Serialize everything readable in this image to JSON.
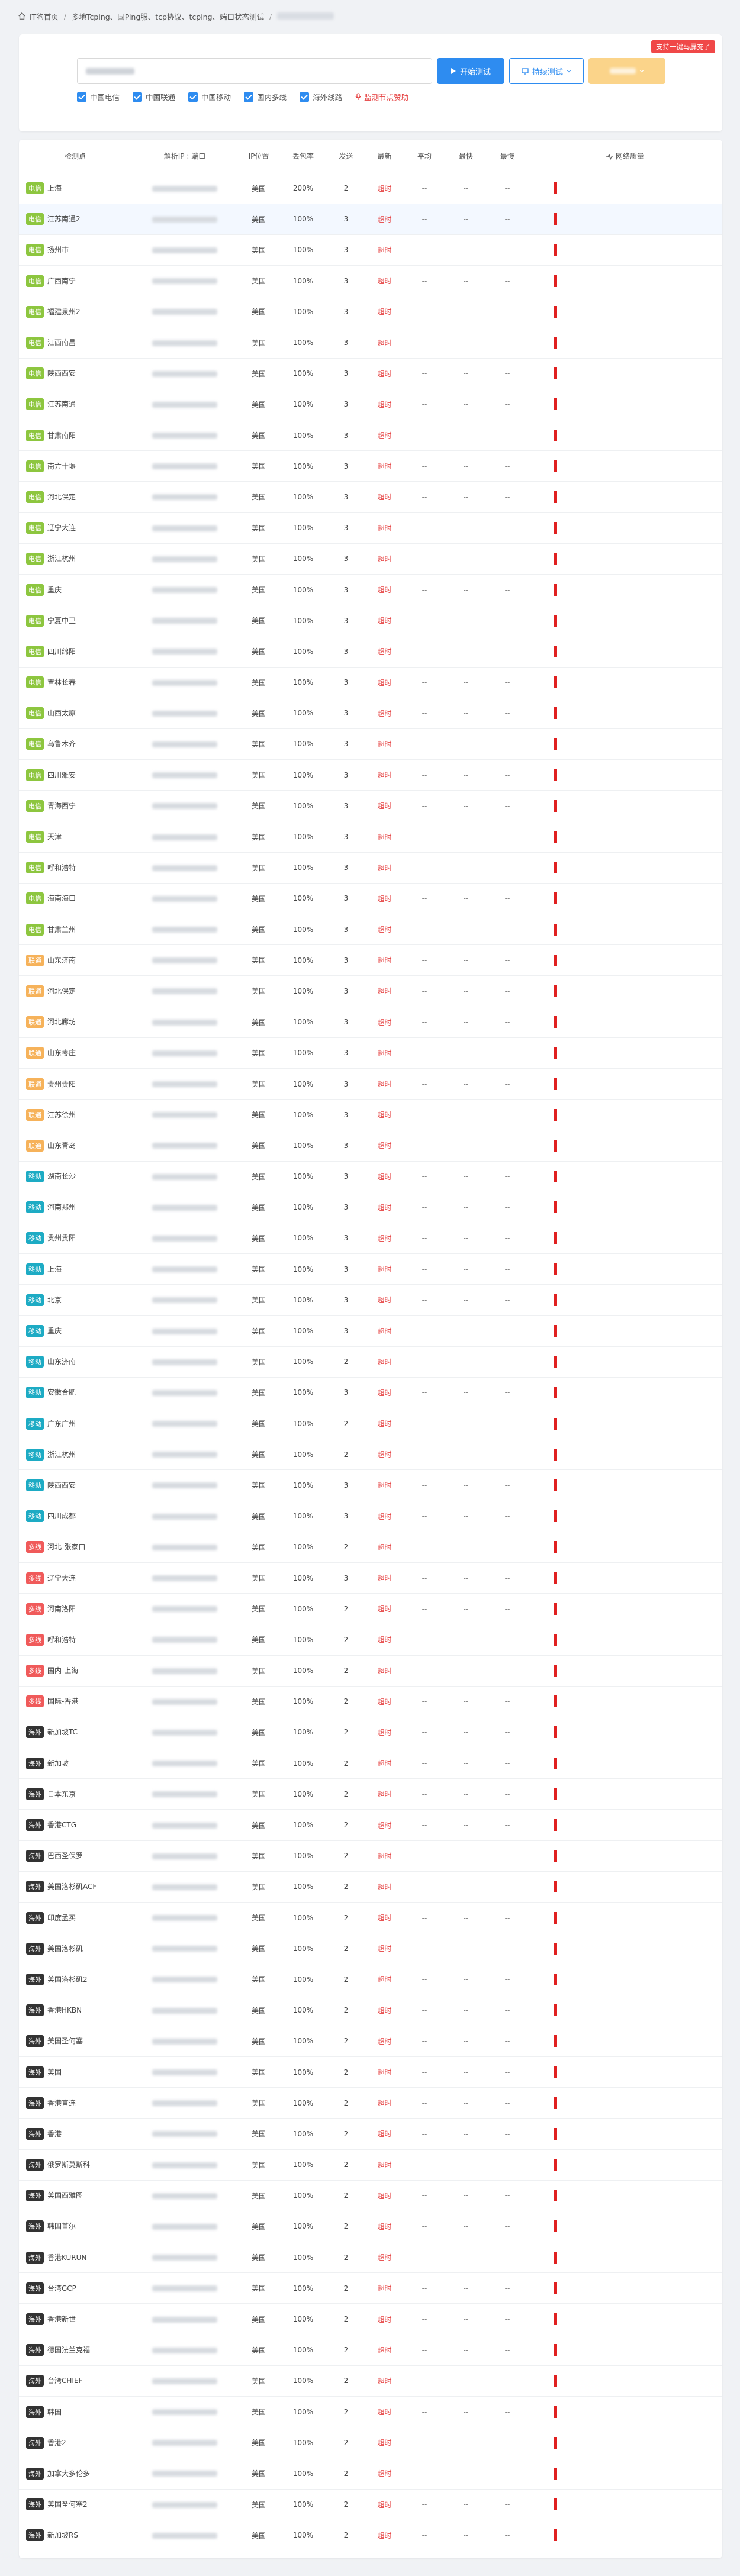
{
  "colors": {
    "电信": "#8dc63f",
    "联通": "#f6b25a",
    "移动": "#1dabc4",
    "多线": "#f05a5a",
    "海外": "#333333",
    "accent": "#2e8cf0",
    "timeout": "#e53e3e"
  },
  "breadcrumb": {
    "home": "IT狗首页",
    "middle": "多地Tcping、国Ping服、tcp协议、tcping、端口状态测试"
  },
  "top": {
    "corner_badge": "支持一键马屏充了",
    "start_button": "开始测试",
    "continuous_button": "持续测试",
    "checkboxes": [
      "中国电信",
      "中国联通",
      "中国移动",
      "国内多线",
      "海外线路"
    ],
    "donate": "监测节点赞助"
  },
  "table": {
    "headers": [
      "检测点",
      "解析IP : 端口",
      "IP位置",
      "丢包率",
      "发送",
      "最新",
      "平均",
      "最快",
      "最慢",
      "网络质量"
    ],
    "rows": [
      {
        "tag": "电信",
        "name": "上海",
        "loc": "美国",
        "loss": "200%",
        "sent": "2"
      },
      {
        "tag": "电信",
        "name": "江苏南通2",
        "loc": "美国",
        "loss": "100%",
        "sent": "3"
      },
      {
        "tag": "电信",
        "name": "扬州市",
        "loc": "美国",
        "loss": "100%",
        "sent": "3"
      },
      {
        "tag": "电信",
        "name": "广西南宁",
        "loc": "美国",
        "loss": "100%",
        "sent": "3"
      },
      {
        "tag": "电信",
        "name": "福建泉州2",
        "loc": "美国",
        "loss": "100%",
        "sent": "3"
      },
      {
        "tag": "电信",
        "name": "江西南昌",
        "loc": "美国",
        "loss": "100%",
        "sent": "3"
      },
      {
        "tag": "电信",
        "name": "陕西西安",
        "loc": "美国",
        "loss": "100%",
        "sent": "3"
      },
      {
        "tag": "电信",
        "name": "江苏南通",
        "loc": "美国",
        "loss": "100%",
        "sent": "3"
      },
      {
        "tag": "电信",
        "name": "甘肃南阳",
        "loc": "美国",
        "loss": "100%",
        "sent": "3"
      },
      {
        "tag": "电信",
        "name": "南方十堰",
        "loc": "美国",
        "loss": "100%",
        "sent": "3"
      },
      {
        "tag": "电信",
        "name": "河北保定",
        "loc": "美国",
        "loss": "100%",
        "sent": "3"
      },
      {
        "tag": "电信",
        "name": "辽宁大连",
        "loc": "美国",
        "loss": "100%",
        "sent": "3"
      },
      {
        "tag": "电信",
        "name": "浙江杭州",
        "loc": "美国",
        "loss": "100%",
        "sent": "3"
      },
      {
        "tag": "电信",
        "name": "重庆",
        "loc": "美国",
        "loss": "100%",
        "sent": "3"
      },
      {
        "tag": "电信",
        "name": "宁夏中卫",
        "loc": "美国",
        "loss": "100%",
        "sent": "3"
      },
      {
        "tag": "电信",
        "name": "四川绵阳",
        "loc": "美国",
        "loss": "100%",
        "sent": "3"
      },
      {
        "tag": "电信",
        "name": "吉林长春",
        "loc": "美国",
        "loss": "100%",
        "sent": "3"
      },
      {
        "tag": "电信",
        "name": "山西太原",
        "loc": "美国",
        "loss": "100%",
        "sent": "3"
      },
      {
        "tag": "电信",
        "name": "乌鲁木齐",
        "loc": "美国",
        "loss": "100%",
        "sent": "3"
      },
      {
        "tag": "电信",
        "name": "四川雅安",
        "loc": "美国",
        "loss": "100%",
        "sent": "3"
      },
      {
        "tag": "电信",
        "name": "青海西宁",
        "loc": "美国",
        "loss": "100%",
        "sent": "3"
      },
      {
        "tag": "电信",
        "name": "天津",
        "loc": "美国",
        "loss": "100%",
        "sent": "3"
      },
      {
        "tag": "电信",
        "name": "呼和浩特",
        "loc": "美国",
        "loss": "100%",
        "sent": "3"
      },
      {
        "tag": "电信",
        "name": "海南海口",
        "loc": "美国",
        "loss": "100%",
        "sent": "3"
      },
      {
        "tag": "电信",
        "name": "甘肃兰州",
        "loc": "美国",
        "loss": "100%",
        "sent": "3"
      },
      {
        "tag": "联通",
        "name": "山东济南",
        "loc": "美国",
        "loss": "100%",
        "sent": "3"
      },
      {
        "tag": "联通",
        "name": "河北保定",
        "loc": "美国",
        "loss": "100%",
        "sent": "3"
      },
      {
        "tag": "联通",
        "name": "河北廊坊",
        "loc": "美国",
        "loss": "100%",
        "sent": "3"
      },
      {
        "tag": "联通",
        "name": "山东枣庄",
        "loc": "美国",
        "loss": "100%",
        "sent": "3"
      },
      {
        "tag": "联通",
        "name": "贵州贵阳",
        "loc": "美国",
        "loss": "100%",
        "sent": "3"
      },
      {
        "tag": "联通",
        "name": "江苏徐州",
        "loc": "美国",
        "loss": "100%",
        "sent": "3"
      },
      {
        "tag": "联通",
        "name": "山东青岛",
        "loc": "美国",
        "loss": "100%",
        "sent": "3"
      },
      {
        "tag": "移动",
        "name": "湖南长沙",
        "loc": "美国",
        "loss": "100%",
        "sent": "3"
      },
      {
        "tag": "移动",
        "name": "河南郑州",
        "loc": "美国",
        "loss": "100%",
        "sent": "3"
      },
      {
        "tag": "移动",
        "name": "贵州贵阳",
        "loc": "美国",
        "loss": "100%",
        "sent": "3"
      },
      {
        "tag": "移动",
        "name": "上海",
        "loc": "美国",
        "loss": "100%",
        "sent": "3"
      },
      {
        "tag": "移动",
        "name": "北京",
        "loc": "美国",
        "loss": "100%",
        "sent": "3"
      },
      {
        "tag": "移动",
        "name": "重庆",
        "loc": "美国",
        "loss": "100%",
        "sent": "3"
      },
      {
        "tag": "移动",
        "name": "山东济南",
        "loc": "美国",
        "loss": "100%",
        "sent": "2"
      },
      {
        "tag": "移动",
        "name": "安徽合肥",
        "loc": "美国",
        "loss": "100%",
        "sent": "3"
      },
      {
        "tag": "移动",
        "name": "广东广州",
        "loc": "美国",
        "loss": "100%",
        "sent": "2"
      },
      {
        "tag": "移动",
        "name": "浙江杭州",
        "loc": "美国",
        "loss": "100%",
        "sent": "2"
      },
      {
        "tag": "移动",
        "name": "陕西西安",
        "loc": "美国",
        "loss": "100%",
        "sent": "3"
      },
      {
        "tag": "移动",
        "name": "四川成都",
        "loc": "美国",
        "loss": "100%",
        "sent": "3"
      },
      {
        "tag": "多线",
        "name": "河北-张家口",
        "loc": "美国",
        "loss": "100%",
        "sent": "2"
      },
      {
        "tag": "多线",
        "name": "辽宁大连",
        "loc": "美国",
        "loss": "100%",
        "sent": "3"
      },
      {
        "tag": "多线",
        "name": "河南洛阳",
        "loc": "美国",
        "loss": "100%",
        "sent": "2"
      },
      {
        "tag": "多线",
        "name": "呼和浩特",
        "loc": "美国",
        "loss": "100%",
        "sent": "2"
      },
      {
        "tag": "多线",
        "name": "国内-上海",
        "loc": "美国",
        "loss": "100%",
        "sent": "2"
      },
      {
        "tag": "多线",
        "name": "国际-香港",
        "loc": "美国",
        "loss": "100%",
        "sent": "2"
      },
      {
        "tag": "海外",
        "name": "新加坡TC",
        "loc": "美国",
        "loss": "100%",
        "sent": "2"
      },
      {
        "tag": "海外",
        "name": "新加坡",
        "loc": "美国",
        "loss": "100%",
        "sent": "2"
      },
      {
        "tag": "海外",
        "name": "日本东京",
        "loc": "美国",
        "loss": "100%",
        "sent": "2"
      },
      {
        "tag": "海外",
        "name": "香港CTG",
        "loc": "美国",
        "loss": "100%",
        "sent": "2"
      },
      {
        "tag": "海外",
        "name": "巴西圣保罗",
        "loc": "美国",
        "loss": "100%",
        "sent": "2"
      },
      {
        "tag": "海外",
        "name": "美国洛杉矶ACF",
        "loc": "美国",
        "loss": "100%",
        "sent": "2"
      },
      {
        "tag": "海外",
        "name": "印度孟买",
        "loc": "美国",
        "loss": "100%",
        "sent": "2"
      },
      {
        "tag": "海外",
        "name": "美国洛杉矶",
        "loc": "美国",
        "loss": "100%",
        "sent": "2"
      },
      {
        "tag": "海外",
        "name": "美国洛杉矶2",
        "loc": "美国",
        "loss": "100%",
        "sent": "2"
      },
      {
        "tag": "海外",
        "name": "香港HKBN",
        "loc": "美国",
        "loss": "100%",
        "sent": "2"
      },
      {
        "tag": "海外",
        "name": "美国圣何塞",
        "loc": "美国",
        "loss": "100%",
        "sent": "2"
      },
      {
        "tag": "海外",
        "name": "美国",
        "loc": "美国",
        "loss": "100%",
        "sent": "2"
      },
      {
        "tag": "海外",
        "name": "香港直连",
        "loc": "美国",
        "loss": "100%",
        "sent": "2"
      },
      {
        "tag": "海外",
        "name": "香港",
        "loc": "美国",
        "loss": "100%",
        "sent": "2"
      },
      {
        "tag": "海外",
        "name": "俄罗斯莫斯科",
        "loc": "美国",
        "loss": "100%",
        "sent": "2"
      },
      {
        "tag": "海外",
        "name": "美国西雅图",
        "loc": "美国",
        "loss": "100%",
        "sent": "2"
      },
      {
        "tag": "海外",
        "name": "韩国首尔",
        "loc": "美国",
        "loss": "100%",
        "sent": "2"
      },
      {
        "tag": "海外",
        "name": "香港KURUN",
        "loc": "美国",
        "loss": "100%",
        "sent": "2"
      },
      {
        "tag": "海外",
        "name": "台湾GCP",
        "loc": "美国",
        "loss": "100%",
        "sent": "2"
      },
      {
        "tag": "海外",
        "name": "香港新世",
        "loc": "美国",
        "loss": "100%",
        "sent": "2"
      },
      {
        "tag": "海外",
        "name": "德国法兰克福",
        "loc": "美国",
        "loss": "100%",
        "sent": "2"
      },
      {
        "tag": "海外",
        "name": "台湾CHIEF",
        "loc": "美国",
        "loss": "100%",
        "sent": "2"
      },
      {
        "tag": "海外",
        "name": "韩国",
        "loc": "美国",
        "loss": "100%",
        "sent": "2"
      },
      {
        "tag": "海外",
        "name": "香港2",
        "loc": "美国",
        "loss": "100%",
        "sent": "2"
      },
      {
        "tag": "海外",
        "name": "加拿大多伦多",
        "loc": "美国",
        "loss": "100%",
        "sent": "2"
      },
      {
        "tag": "海外",
        "name": "美国圣何塞2",
        "loc": "美国",
        "loss": "100%",
        "sent": "2"
      },
      {
        "tag": "海外",
        "name": "新加坡RS",
        "loc": "美国",
        "loss": "100%",
        "sent": "2"
      }
    ],
    "latest_value": "超时",
    "dash_value": "--"
  }
}
